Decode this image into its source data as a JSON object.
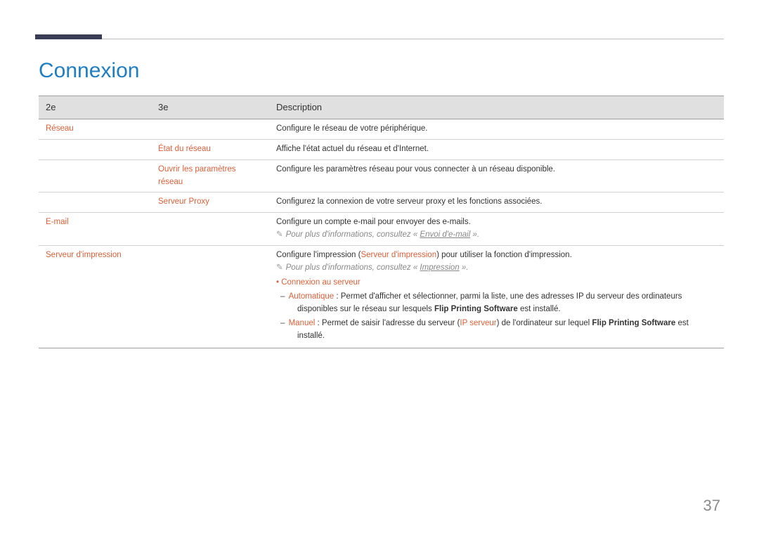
{
  "title": "Connexion",
  "page_number": "37",
  "headers": {
    "c1": "2e",
    "c2": "3e",
    "c3": "Description"
  },
  "rows": {
    "reseau": {
      "label": "Réseau",
      "desc": "Configure le réseau de votre périphérique."
    },
    "etat": {
      "label": "État du réseau",
      "desc": "Affiche l'état actuel du réseau et d'Internet."
    },
    "ouvrir": {
      "label": "Ouvrir les paramètres réseau",
      "desc": "Configure les paramètres réseau pour vous connecter à un réseau disponible."
    },
    "proxy": {
      "label": "Serveur Proxy",
      "desc": "Configurez la connexion de votre serveur proxy et les fonctions associées."
    },
    "email": {
      "label": "E-mail",
      "desc": "Configure un compte e-mail pour envoyer des e-mails.",
      "note_prefix": "Pour plus d'informations, consultez « ",
      "note_link": "Envoi d'e-mail",
      "note_suffix": " »."
    },
    "print": {
      "label": "Serveur d'impression",
      "desc_before": "Configure l'impression (",
      "desc_term": "Serveur d'impression",
      "desc_after": ") pour utiliser la fonction d'impression.",
      "note_prefix": "Pour plus d'informations, consultez « ",
      "note_link": "Impression",
      "note_suffix": " ».",
      "server_connection": "Connexion au serveur",
      "auto_label": "Automatique",
      "auto_text": " : Permet d'afficher et sélectionner, parmi la liste, une des adresses IP du serveur des ordinateurs disponibles sur le réseau sur lesquels ",
      "auto_software": "Flip Printing Software",
      "auto_tail": " est installé.",
      "manual_label": "Manuel",
      "manual_text_1": " : Permet de saisir l'adresse du serveur (",
      "manual_ip": "IP serveur",
      "manual_text_2": ") de l'ordinateur sur lequel ",
      "manual_software": "Flip Printing Software",
      "manual_tail": " est installé."
    }
  }
}
